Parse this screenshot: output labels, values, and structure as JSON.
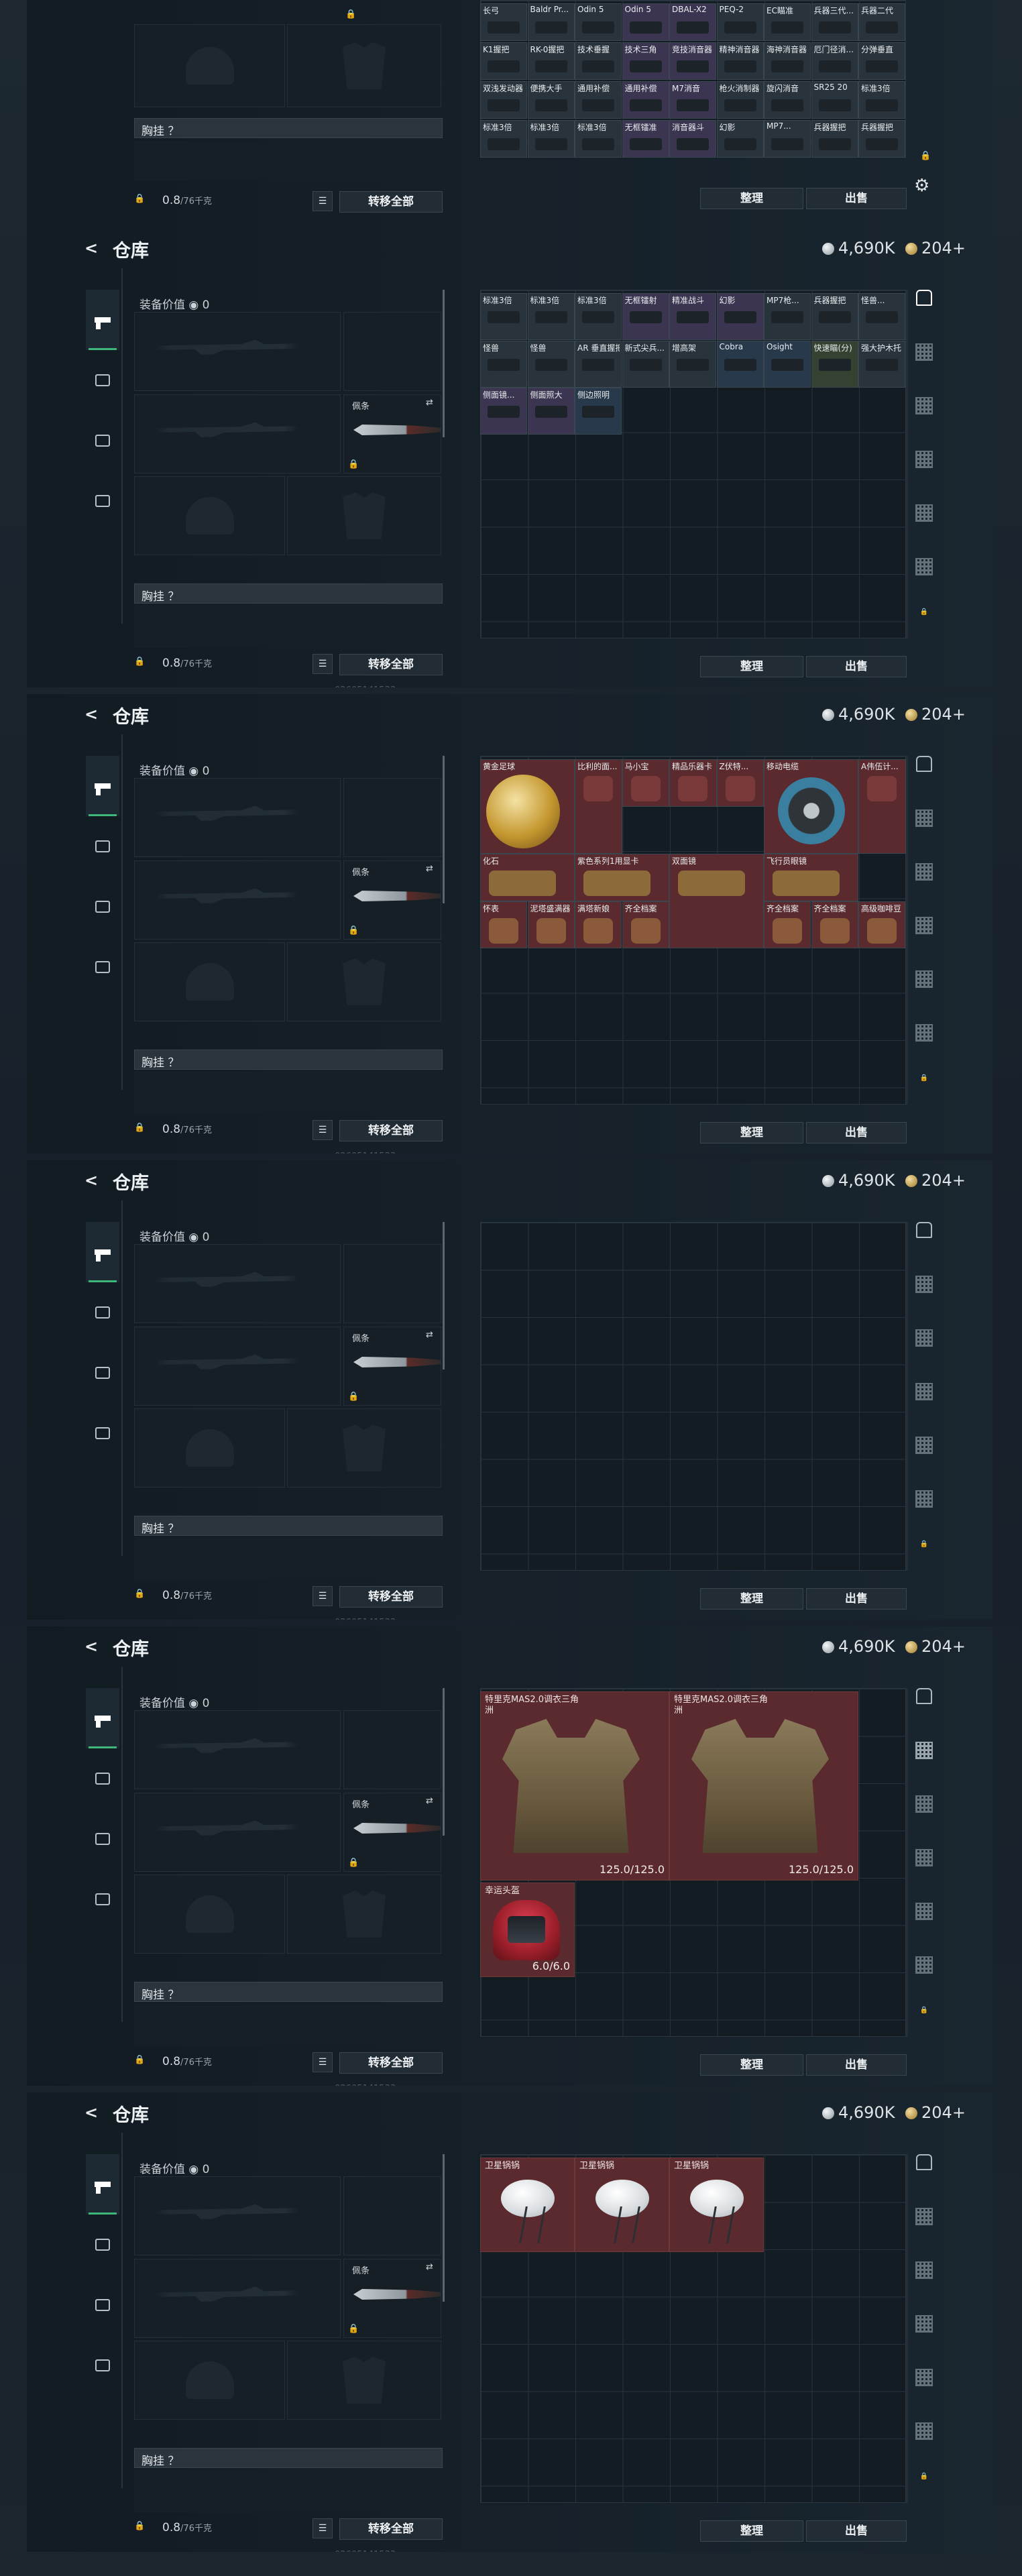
{
  "header": {
    "back_icon": "back-arrow-icon",
    "title": "仓库",
    "silver": "4,690K",
    "gold": "204",
    "plus": "+"
  },
  "equipment": {
    "value_label": "装备价值",
    "value": "0",
    "melee_label": "佩条",
    "chest_label": "胸挂 ？",
    "weight_value": "0.8",
    "weight_max": "/76千克",
    "transfer_all": "转移全部",
    "sort": "整理",
    "sell": "出售",
    "footer_id": "02605141533"
  },
  "sidebar_icons": [
    "shop-icon",
    "qr-tab-icon",
    "qr-tab-icon",
    "qr-tab-icon",
    "qr-tab-icon",
    "qr-tab-icon",
    "lock-icon"
  ],
  "panel1_items": [
    [
      "长弓",
      "Baldr Pr...",
      "Odin 5",
      "Odin 5",
      "DBAL-X2",
      "PEQ-2",
      "EC瞄准",
      "兵器三代...",
      "兵器二代"
    ],
    [
      "K1握把",
      "RK-0握把",
      "技术垂握",
      "技术三角",
      "竞技消音器",
      "精神消音器",
      "海神消音器",
      "厄门径消...",
      "分弹垂直"
    ],
    [
      "双浅发动器",
      "便携大手",
      "通用补偿",
      "通用补偿",
      "M7消音",
      "枪火消制器",
      "旋闪消音",
      "SR25 20",
      "标准3倍"
    ],
    [
      "标准3倍",
      "标准3倍",
      "标准3倍",
      "无框镭准",
      "消音器斗",
      "幻影",
      "MP7...",
      "兵器握把",
      "兵器握把"
    ]
  ],
  "panel2_items": [
    [
      "标准3倍",
      "标准3倍",
      "标准3倍",
      "无框镭射",
      "精准战斗",
      "幻影",
      "MP7枪...",
      "兵器握把",
      "怪兽..."
    ],
    [
      "怪兽",
      "怪兽",
      "AR 垂直握把",
      "新式尖兵...",
      "增高架",
      "Cobra",
      "Osight",
      "快速瞄(分)",
      "强大护木托"
    ],
    [
      "侧面镜...",
      "侧面照大",
      "侧边照明"
    ]
  ],
  "panel3_items": {
    "row1": [
      "黄金足球",
      "比利的面...",
      "马小宝",
      "精品乐器卡",
      "Z伏特...",
      "移动电缆",
      "A伟伍计..."
    ],
    "row2": [
      "化石",
      "紫色系列1用显卡",
      "双面镜",
      "飞行员眼镜"
    ],
    "row3": [
      "怀表",
      "泥塔盛满器",
      "满塔新娘",
      "齐全档案",
      "齐全档案",
      "齐全档案",
      "高级咖啡豆"
    ]
  },
  "panel5": {
    "vest1_label": "特里克MAS2.0调衣三角洲",
    "vest1_dur": "125.0/125.0",
    "vest2_label": "特里克MAS2.0调衣三角洲",
    "vest2_dur": "125.0/125.0",
    "helm_label": "幸运头盔",
    "helm_dur": "6.0/6.0"
  },
  "panel6": {
    "dish_label": "卫星锅锅"
  }
}
